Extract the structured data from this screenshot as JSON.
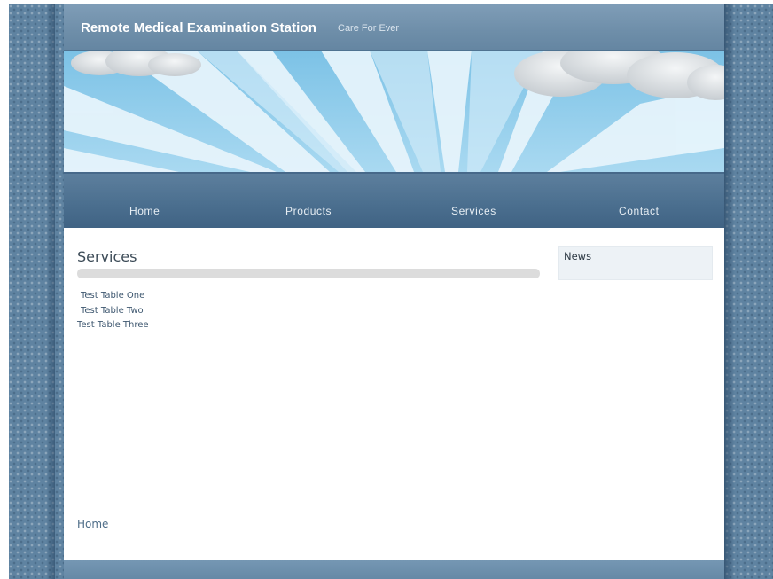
{
  "header": {
    "title": "Remote Medical Examination Station",
    "tagline": "Care For Ever"
  },
  "nav": {
    "items": [
      {
        "label": "Home"
      },
      {
        "label": "Products"
      },
      {
        "label": "Services"
      },
      {
        "label": "Contact"
      }
    ]
  },
  "main": {
    "heading": "Services",
    "links": [
      {
        "label": "Test Table One"
      },
      {
        "label": "Test Table Two"
      },
      {
        "label": "Test Table Three"
      }
    ]
  },
  "sidebar": {
    "news_title": "News"
  },
  "footer": {
    "home_label": "Home"
  },
  "colors": {
    "frame": "#5f83a1",
    "header": "#7292ad",
    "nav": "#4b6f8f",
    "sky": "#8ecbea"
  }
}
